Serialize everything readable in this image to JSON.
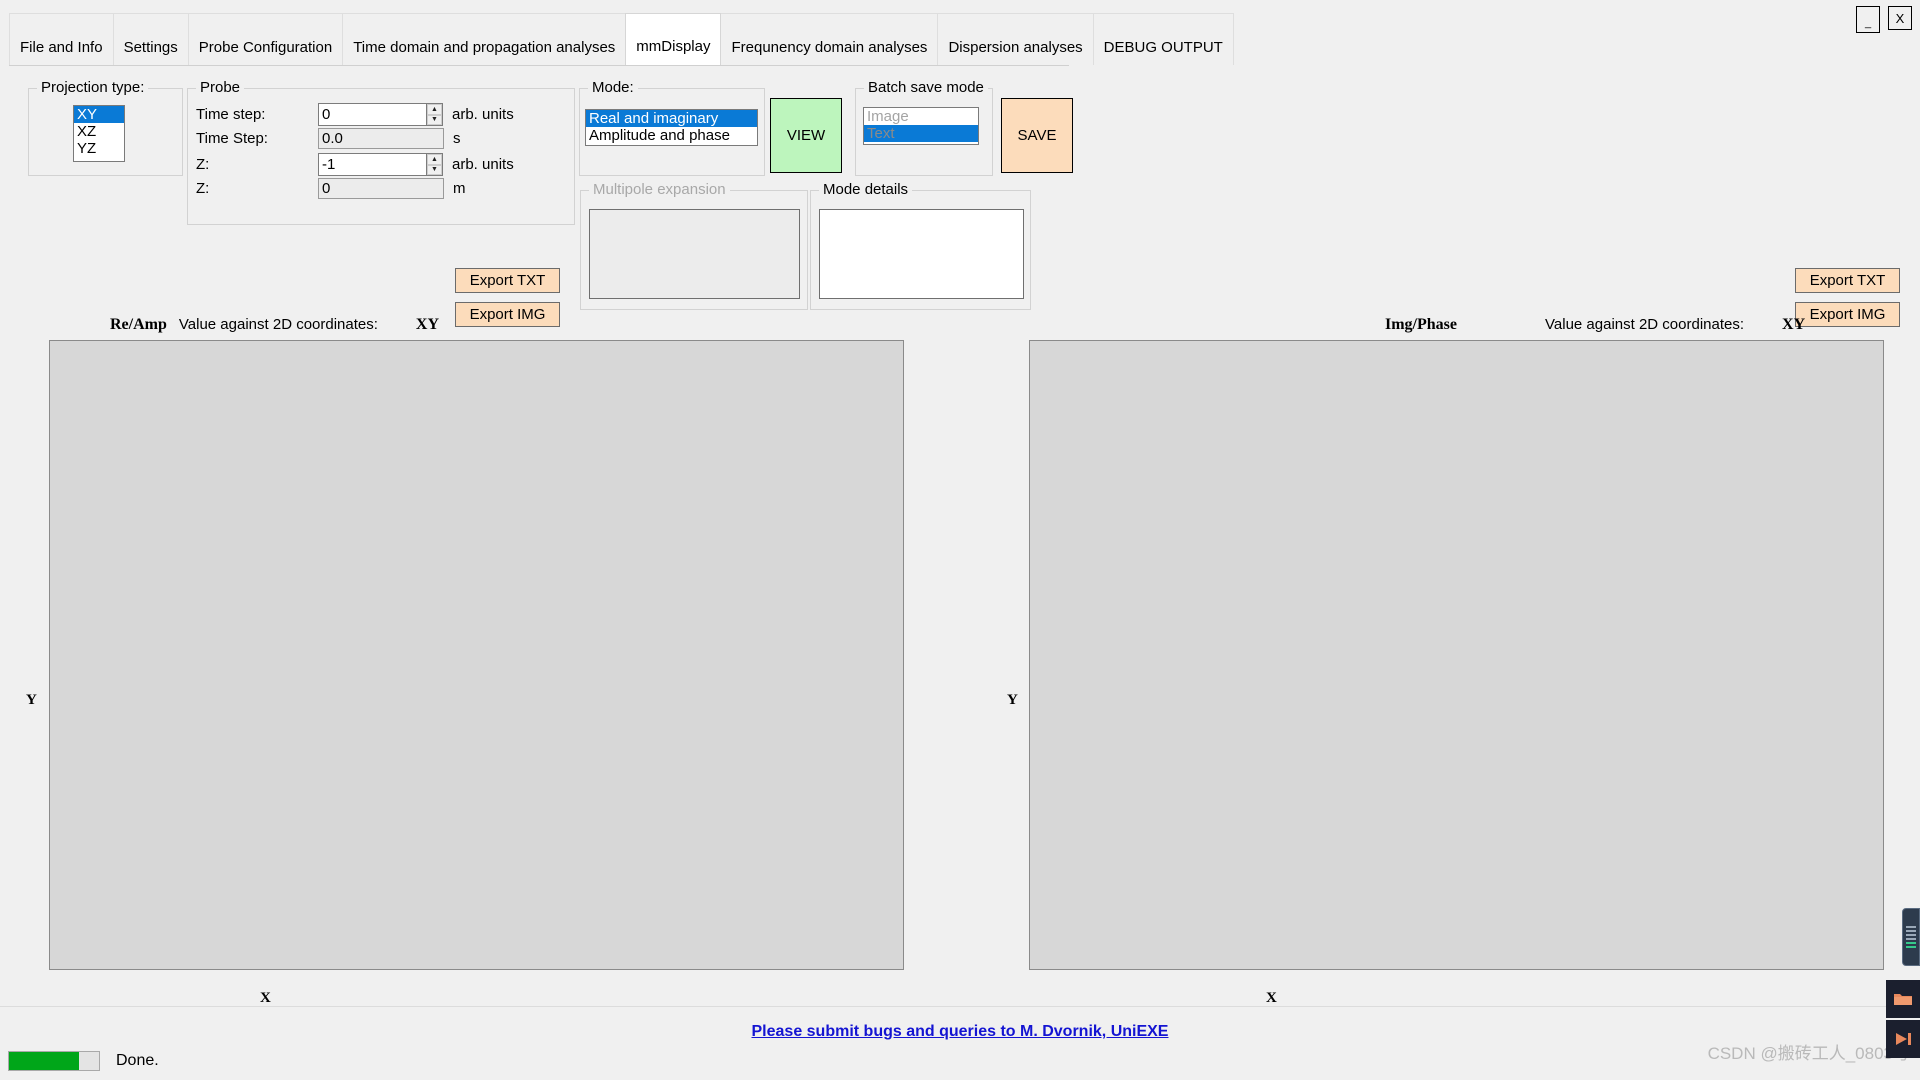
{
  "window": {
    "minimize_label": "_",
    "close_label": "X"
  },
  "tabs": [
    {
      "label": "File and Info",
      "active": false
    },
    {
      "label": "Settings",
      "active": false
    },
    {
      "label": "Probe Configuration",
      "active": false
    },
    {
      "label": "Time domain and propagation analyses",
      "active": false
    },
    {
      "label": "mmDisplay",
      "active": true
    },
    {
      "label": "Frequnency domain analyses",
      "active": false
    },
    {
      "label": "Dispersion analyses",
      "active": false
    },
    {
      "label": "DEBUG OUTPUT",
      "active": false
    }
  ],
  "projection": {
    "legend": "Projection type:",
    "options": [
      "XY",
      "XZ",
      "YZ"
    ],
    "selected": "XY"
  },
  "probe": {
    "legend": "Probe",
    "fields": [
      {
        "label": "Time step:",
        "value": "0",
        "unit": "arb. units",
        "spinner": true,
        "readonly": false
      },
      {
        "label": "Time Step:",
        "value": "0.0",
        "unit": "s",
        "spinner": false,
        "readonly": true
      },
      {
        "label": "Z:",
        "value": "-1",
        "unit": "arb. units",
        "spinner": true,
        "readonly": false
      },
      {
        "label": "Z:",
        "value": "0",
        "unit": "m",
        "spinner": false,
        "readonly": true
      }
    ]
  },
  "mode": {
    "legend": "Mode:",
    "options": [
      "Real and imaginary",
      "Amplitude and phase"
    ],
    "selected": "Real and imaginary"
  },
  "view_button": {
    "label": "VIEW",
    "color": "#bdf5bd"
  },
  "batch_save": {
    "legend": "Batch save mode",
    "options": [
      "Image",
      "Text"
    ],
    "selected": "Text",
    "disabled": true
  },
  "save_button": {
    "label": "SAVE",
    "color": "#fcdcbb"
  },
  "multipole": {
    "legend": "Multipole expansion",
    "content": "",
    "disabled": true
  },
  "mode_details": {
    "legend": "Mode details",
    "content": ""
  },
  "exports": {
    "left": {
      "txt": "Export TXT",
      "img": "Export IMG"
    },
    "right": {
      "txt": "Export TXT",
      "img": "Export IMG"
    }
  },
  "plots": [
    {
      "component": "Re/Amp",
      "caption": "Value against 2D coordinates:",
      "projection": "XY",
      "x_label": "X",
      "y_label": "Y",
      "canvas_color": "#d7d7d7"
    },
    {
      "component": "Img/Phase",
      "caption": "Value against 2D coordinates:",
      "projection": "XY",
      "x_label": "X",
      "y_label": "Y",
      "canvas_color": "#d7d7d7"
    }
  ],
  "footer": {
    "link_text": "Please submit bugs and queries to M. Dvornik, UniEXE"
  },
  "status": {
    "text": "Done.",
    "progress_percent": 78,
    "progress_color": "#00a619"
  },
  "watermark": "CSDN @搬砖工人_0803号"
}
